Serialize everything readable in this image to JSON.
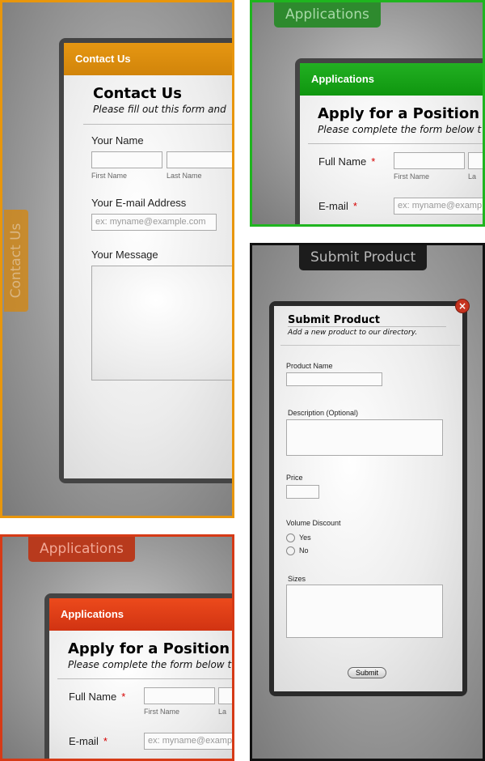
{
  "contact_panel": {
    "side_tab_label": "Contact Us",
    "header": "Contact Us",
    "title": "Contact Us",
    "subtitle": "Please fill out this form and",
    "name_label": "Your Name",
    "first_name_sub": "First Name",
    "last_name_sub": "Last Name",
    "email_label": "Your E-mail Address",
    "email_placeholder": "ex: myname@example.com",
    "message_label": "Your Message",
    "colors": {
      "accent": "#e8960c",
      "header": "#d98a0b"
    }
  },
  "green_panel": {
    "top_tab_label": "Applications",
    "header": "Applications",
    "title": "Apply for a Position",
    "subtitle": "Please complete the form below t",
    "full_name_label": "Full Name",
    "required_mark": "*",
    "first_name_sub": "First Name",
    "last_name_sub_partial": "La",
    "email_label": "E-mail",
    "email_placeholder": "ex: myname@examp",
    "colors": {
      "accent": "#1fb51f",
      "header": "#139c13"
    }
  },
  "red_panel": {
    "top_tab_label": "Applications",
    "header": "Applications",
    "title": "Apply for a Position",
    "subtitle": "Please complete the form below t",
    "full_name_label": "Full Name",
    "required_mark": "*",
    "first_name_sub": "First Name",
    "last_name_sub_partial": "La",
    "email_label": "E-mail",
    "email_placeholder": "ex: myname@examp",
    "colors": {
      "accent": "#d63a16",
      "header": "#e0441a"
    }
  },
  "product_panel": {
    "top_tab_label": "Submit Product",
    "title": "Submit Product",
    "subtitle": "Add a new product to our directory.",
    "product_name_label": "Product Name",
    "description_label": "Description (Optional)",
    "price_label": "Price",
    "volume_discount_label": "Volume Discount",
    "option_yes": "Yes",
    "option_no": "No",
    "sizes_label": "Sizes",
    "submit_label": "Submit",
    "close_icon": "close-icon",
    "colors": {
      "accent": "#111111",
      "close": "#c6331f"
    }
  }
}
